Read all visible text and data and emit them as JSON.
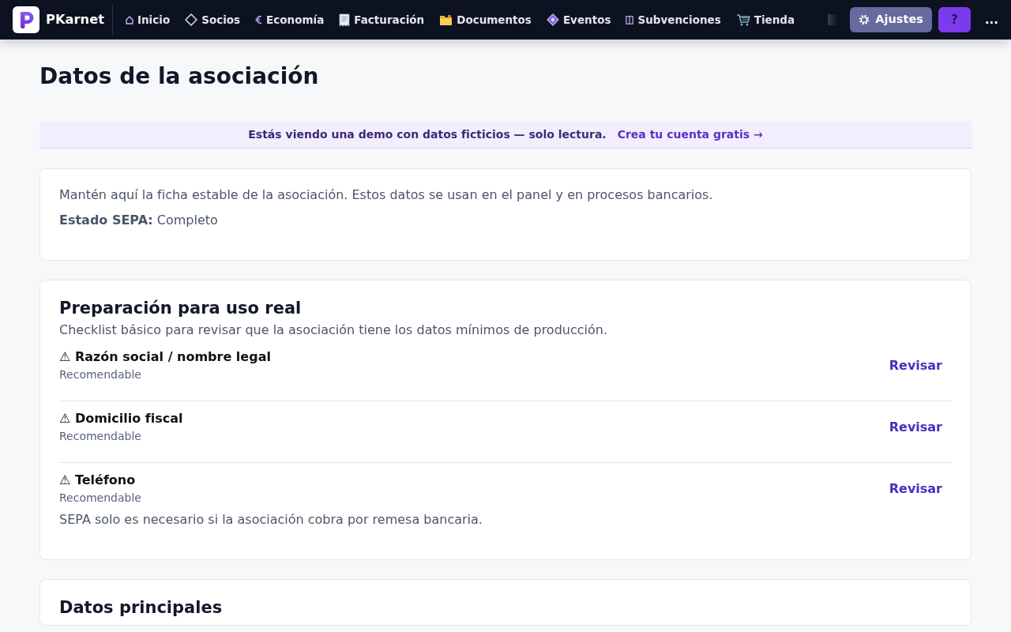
{
  "brand": {
    "name": "PKarnet"
  },
  "nav": [
    {
      "label": "Inicio"
    },
    {
      "label": "Socios"
    },
    {
      "label": "Economía"
    },
    {
      "label": "Facturación"
    },
    {
      "label": "Documentos"
    },
    {
      "label": "Eventos"
    },
    {
      "label": "Subvenciones"
    },
    {
      "label": "Tienda"
    }
  ],
  "nav_actions": {
    "settings": "Ajustes",
    "help": "?",
    "more": "..."
  },
  "page_title": "Datos de la asociación",
  "demo_banner": {
    "text": "Estás viendo una demo con datos ficticios — solo lectura.",
    "link": "Crea tu cuenta gratis →"
  },
  "intro_card": {
    "description": "Mantén aquí la ficha estable de la asociación. Estos datos se usan en el panel y en procesos bancarios.",
    "sepa_status": {
      "label": "Estado SEPA:",
      "value": "Completo"
    }
  },
  "readiness": {
    "title": "Preparación para uso real",
    "subtitle": "Checklist básico para revisar que la asociación tiene los datos mínimos de producción.",
    "items": [
      {
        "title": "⚠ Razón social / nombre legal",
        "status": "Recomendable",
        "action": "Revisar"
      },
      {
        "title": "⚠ Domicilio fiscal",
        "status": "Recomendable",
        "action": "Revisar"
      },
      {
        "title": "⚠ Teléfono",
        "status": "Recomendable",
        "action": "Revisar"
      }
    ],
    "note": "SEPA solo es necesario si la asociación cobra por remesa bancaria."
  },
  "main_data": {
    "title": "Datos principales"
  }
}
